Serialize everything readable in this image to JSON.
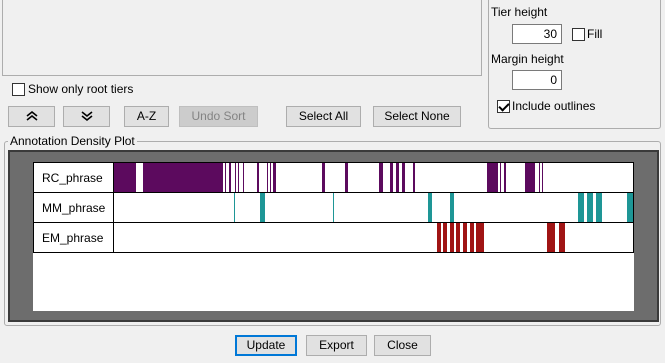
{
  "tier_list": {
    "show_only_root_label": "Show only root tiers",
    "show_only_root_checked": false
  },
  "options": {
    "tier_height_label": "Tier height",
    "tier_height_value": "30",
    "fill_label": "Fill",
    "fill_checked": false,
    "margin_height_label": "Margin height",
    "margin_height_value": "0",
    "include_outlines_label": "Include outlines",
    "include_outlines_checked": true
  },
  "toolbar": {
    "move_up_icon": "double-chevron-up-icon",
    "move_down_icon": "double-chevron-down-icon",
    "sort_az_label": "A-Z",
    "undo_sort_label": "Undo Sort",
    "select_all_label": "Select All",
    "select_none_label": "Select None"
  },
  "plot": {
    "group_title": "Annotation Density Plot",
    "colors": {
      "RC_phrase": "#5c0a5e",
      "MM_phrase": "#1e9696",
      "EM_phrase": "#a01414"
    },
    "tiers": [
      {
        "name": "RC_phrase",
        "segments": [
          [
            0,
            23
          ],
          [
            30,
            110
          ],
          [
            112,
            113
          ],
          [
            116,
            118
          ],
          [
            122,
            123
          ],
          [
            125,
            126
          ],
          [
            130,
            131
          ],
          [
            144,
            146
          ],
          [
            154,
            155
          ],
          [
            157,
            158
          ],
          [
            160,
            163
          ],
          [
            209,
            212
          ],
          [
            232,
            235
          ],
          [
            266,
            270
          ],
          [
            277,
            280
          ],
          [
            283,
            286
          ],
          [
            289,
            292
          ],
          [
            300,
            302
          ],
          [
            374,
            385
          ],
          [
            387,
            388
          ],
          [
            391,
            393
          ],
          [
            412,
            422
          ],
          [
            426,
            427
          ],
          [
            429,
            430
          ]
        ]
      },
      {
        "name": "MM_phrase",
        "segments": [
          [
            121,
            122
          ],
          [
            147,
            152
          ],
          [
            220,
            221
          ],
          [
            315,
            319
          ],
          [
            337,
            341
          ],
          [
            465,
            471
          ],
          [
            474,
            480
          ],
          [
            483,
            489
          ],
          [
            514,
            520
          ]
        ]
      },
      {
        "name": "EM_phrase",
        "segments": [
          [
            324,
            328
          ],
          [
            330,
            334
          ],
          [
            337,
            341
          ],
          [
            343,
            347
          ],
          [
            350,
            354
          ],
          [
            357,
            361
          ],
          [
            363,
            371
          ],
          [
            434,
            442
          ],
          [
            446,
            452
          ]
        ]
      }
    ]
  },
  "bottom_buttons": {
    "update_label": "Update",
    "export_label": "Export",
    "close_label": "Close"
  }
}
